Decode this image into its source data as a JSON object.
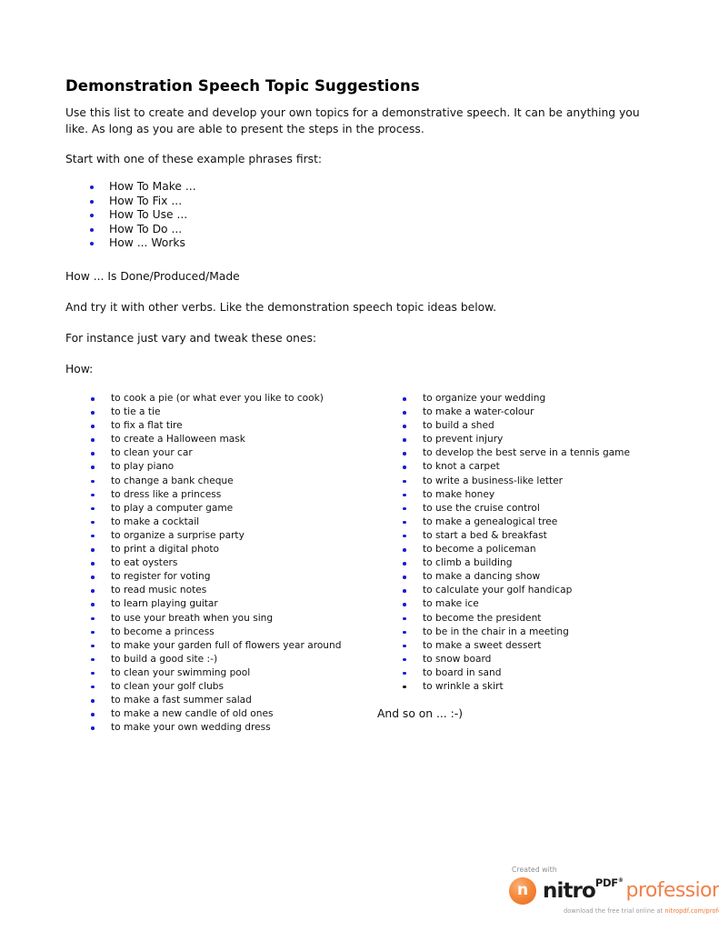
{
  "document": {
    "title": "Demonstration Speech Topic Suggestions",
    "intro": "Use this list to create and develop your own topics for a demonstrative speech. It can be anything you like. As long as you are able to present the steps in the process.",
    "start_line": "Start with one of these example phrases first:",
    "phrase_list": [
      "How To Make ...",
      "How To Fix ...",
      "How To Use ...",
      "How To Do ...",
      "How ... Works"
    ],
    "done_line": "How ... Is Done/Produced/Made",
    "verbs_line": "And try it with other verbs. Like the demonstration speech topic ideas below.",
    "instance_line": "For instance just vary and tweak these ones:",
    "how_label": "How:",
    "topics_left": [
      "to cook a pie (or what ever you like to cook)",
      "to tie a tie",
      "to fix a flat tire",
      "to create a Halloween mask",
      "to clean your car",
      "to play piano",
      "to change a bank cheque",
      "to dress like a princess",
      "to play a computer game",
      "to make a cocktail",
      "to organize a surprise party",
      "to print a digital photo",
      "to eat oysters",
      "to register for voting",
      "to read music notes",
      "to learn playing guitar",
      "to use your breath when you sing",
      "to become a princess",
      "to make your garden full of flowers year around",
      "to build a good site :-)",
      "to clean your swimming pool",
      "to clean your golf clubs",
      "to make a fast summer salad",
      "to make a new candle of old ones",
      "to make your own wedding dress"
    ],
    "topics_right": [
      "to organize your wedding",
      "to make a water-colour",
      "to build a shed",
      "to prevent injury",
      "to develop the best serve in a tennis game",
      "to knot a carpet",
      "to write a business-like letter",
      "to make honey",
      "to use the cruise control",
      "to make a genealogical tree",
      "to start a bed & breakfast",
      "to become a policeman",
      "to climb a building",
      "to make a dancing show",
      "to calculate your golf handicap",
      "to make ice",
      "to become the president",
      "to be in the chair in a meeting",
      "to make a sweet dessert",
      "to snow board",
      "to board in sand",
      "to wrinkle a skirt"
    ],
    "and_so_on": "And so on ... :-)"
  },
  "footer": {
    "created_with": "Created with",
    "logo_glyph": "n",
    "brand_name": "nitro",
    "brand_format": "PDF",
    "brand_registered": "®",
    "brand_edition": "professional",
    "trial_text": "download the free trial online at ",
    "trial_url": "nitropdf.com/professional"
  },
  "colors": {
    "bullet_blue": "#1b1bcf",
    "bullet_dark": "#1a1a1a",
    "nitro_orange": "#f0804b",
    "url_orange": "#ee7733"
  }
}
